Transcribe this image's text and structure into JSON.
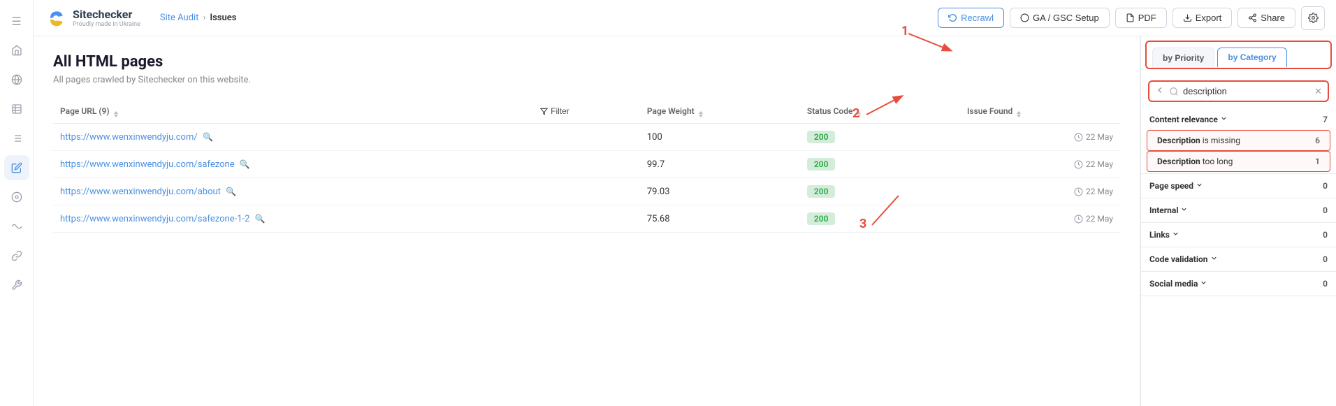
{
  "app": {
    "logo_title": "Sitechecker",
    "logo_subtitle": "Proudly made in Ukraine",
    "nav_items": [
      {
        "name": "menu-icon",
        "icon": "☰"
      },
      {
        "name": "home-icon",
        "icon": "🏠"
      },
      {
        "name": "globe-icon",
        "icon": "🌐"
      },
      {
        "name": "table-icon",
        "icon": "▦"
      },
      {
        "name": "list-icon",
        "icon": "≡"
      },
      {
        "name": "edit-icon",
        "icon": "✎"
      },
      {
        "name": "analytics-icon",
        "icon": "◎"
      },
      {
        "name": "link2-icon",
        "icon": "⚡"
      },
      {
        "name": "link-icon",
        "icon": "🔗"
      },
      {
        "name": "tools-icon",
        "icon": "✦"
      }
    ]
  },
  "topbar": {
    "breadcrumb_parent": "Site Audit",
    "breadcrumb_separator": "›",
    "breadcrumb_current": "Issues",
    "buttons": {
      "recrawl": "Recrawl",
      "ga_gsc": "GA / GSC Setup",
      "pdf": "PDF",
      "export": "Export",
      "share": "Share"
    }
  },
  "main": {
    "title": "All HTML pages",
    "subtitle": "All pages crawled by Sitechecker on this website.",
    "table": {
      "columns": [
        {
          "label": "Page URL (9)",
          "sortable": true
        },
        {
          "label": "Filter"
        },
        {
          "label": "Page Weight",
          "sortable": true
        },
        {
          "label": "Status Code",
          "sortable": true
        },
        {
          "label": "Issue Found",
          "sortable": true
        }
      ],
      "rows": [
        {
          "url": "https://www.wenxinwendyju.com/",
          "weight": "100",
          "status": "200",
          "date": "22 May"
        },
        {
          "url": "https://www.wenxinwendyju.com/safezone",
          "weight": "99.7",
          "status": "200",
          "date": "22 May"
        },
        {
          "url": "https://www.wenxinwendyju.com/about",
          "weight": "79.03",
          "status": "200",
          "date": "22 May"
        },
        {
          "url": "https://www.wenxinwendyju.com/safezone-1-2",
          "weight": "75.68",
          "status": "200",
          "date": "22 May"
        }
      ]
    }
  },
  "sidebar": {
    "tabs": [
      {
        "label": "by Priority"
      },
      {
        "label": "by Category",
        "active": true
      }
    ],
    "search_placeholder": "description",
    "search_value": "description",
    "sections": [
      {
        "name": "Content relevance",
        "count": "7",
        "expanded": true,
        "items": [
          {
            "label_prefix": "Description",
            "label_suffix": " is missing",
            "count": "6",
            "highlighted": true
          },
          {
            "label_prefix": "Description",
            "label_suffix": " too long",
            "count": "1",
            "highlighted": true
          }
        ]
      },
      {
        "name": "Page speed",
        "count": "0",
        "expanded": false,
        "items": []
      },
      {
        "name": "Internal",
        "count": "0",
        "expanded": false,
        "items": []
      },
      {
        "name": "Links",
        "count": "0",
        "expanded": false,
        "items": []
      },
      {
        "name": "Code validation",
        "count": "0",
        "expanded": false,
        "items": []
      },
      {
        "name": "Social media",
        "count": "0",
        "expanded": false,
        "items": []
      }
    ]
  },
  "annotations": {
    "label_1": "1",
    "label_2": "2",
    "label_3": "3"
  }
}
